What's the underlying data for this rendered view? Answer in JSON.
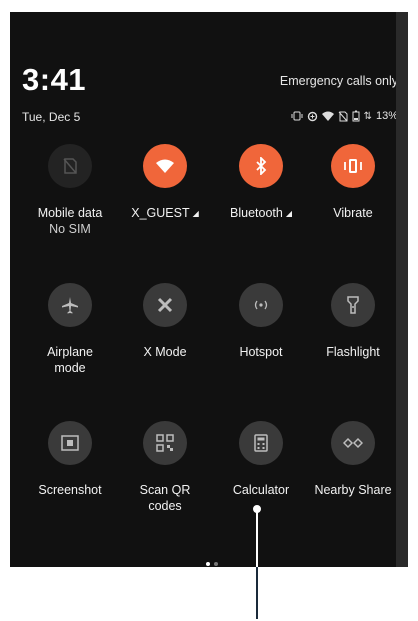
{
  "status_bar": {
    "time": "3:41",
    "date": "Tue, Dec 5",
    "carrier_text": "Emergency calls only",
    "battery": "13%",
    "icons": [
      "vibrate-icon",
      "data-saver-icon",
      "wifi-icon",
      "no-sim-icon",
      "battery-icon"
    ]
  },
  "tiles": [
    {
      "label": "Mobile data",
      "sub": "No SIM",
      "icon": "sim-off-icon",
      "state": "unavailable"
    },
    {
      "label": "X_GUEST",
      "icon": "wifi-icon",
      "state": "on",
      "has_arrow": true
    },
    {
      "label": "Bluetooth",
      "icon": "bluetooth-icon",
      "state": "on",
      "has_arrow": true
    },
    {
      "label": "Vibrate",
      "icon": "vibrate-icon",
      "state": "on"
    },
    {
      "label": "Airplane",
      "sub": "mode",
      "icon": "airplane-icon",
      "state": "off"
    },
    {
      "label": "X Mode",
      "icon": "x-mode-icon",
      "state": "off"
    },
    {
      "label": "Hotspot",
      "icon": "hotspot-icon",
      "state": "off"
    },
    {
      "label": "Flashlight",
      "icon": "flashlight-icon",
      "state": "off"
    },
    {
      "label": "Screenshot",
      "icon": "screenshot-icon",
      "state": "off"
    },
    {
      "label": "Scan QR",
      "sub": "codes",
      "icon": "qr-code-icon",
      "state": "off"
    },
    {
      "label": "Calculator",
      "icon": "calculator-icon",
      "state": "off"
    },
    {
      "label": "Nearby Share",
      "icon": "nearby-share-icon",
      "state": "off"
    }
  ],
  "colors": {
    "accent": "#f0663a",
    "background": "#111111",
    "tile_off": "#3a3a3a"
  },
  "page_indicator": {
    "pages": 2,
    "current": 1
  }
}
